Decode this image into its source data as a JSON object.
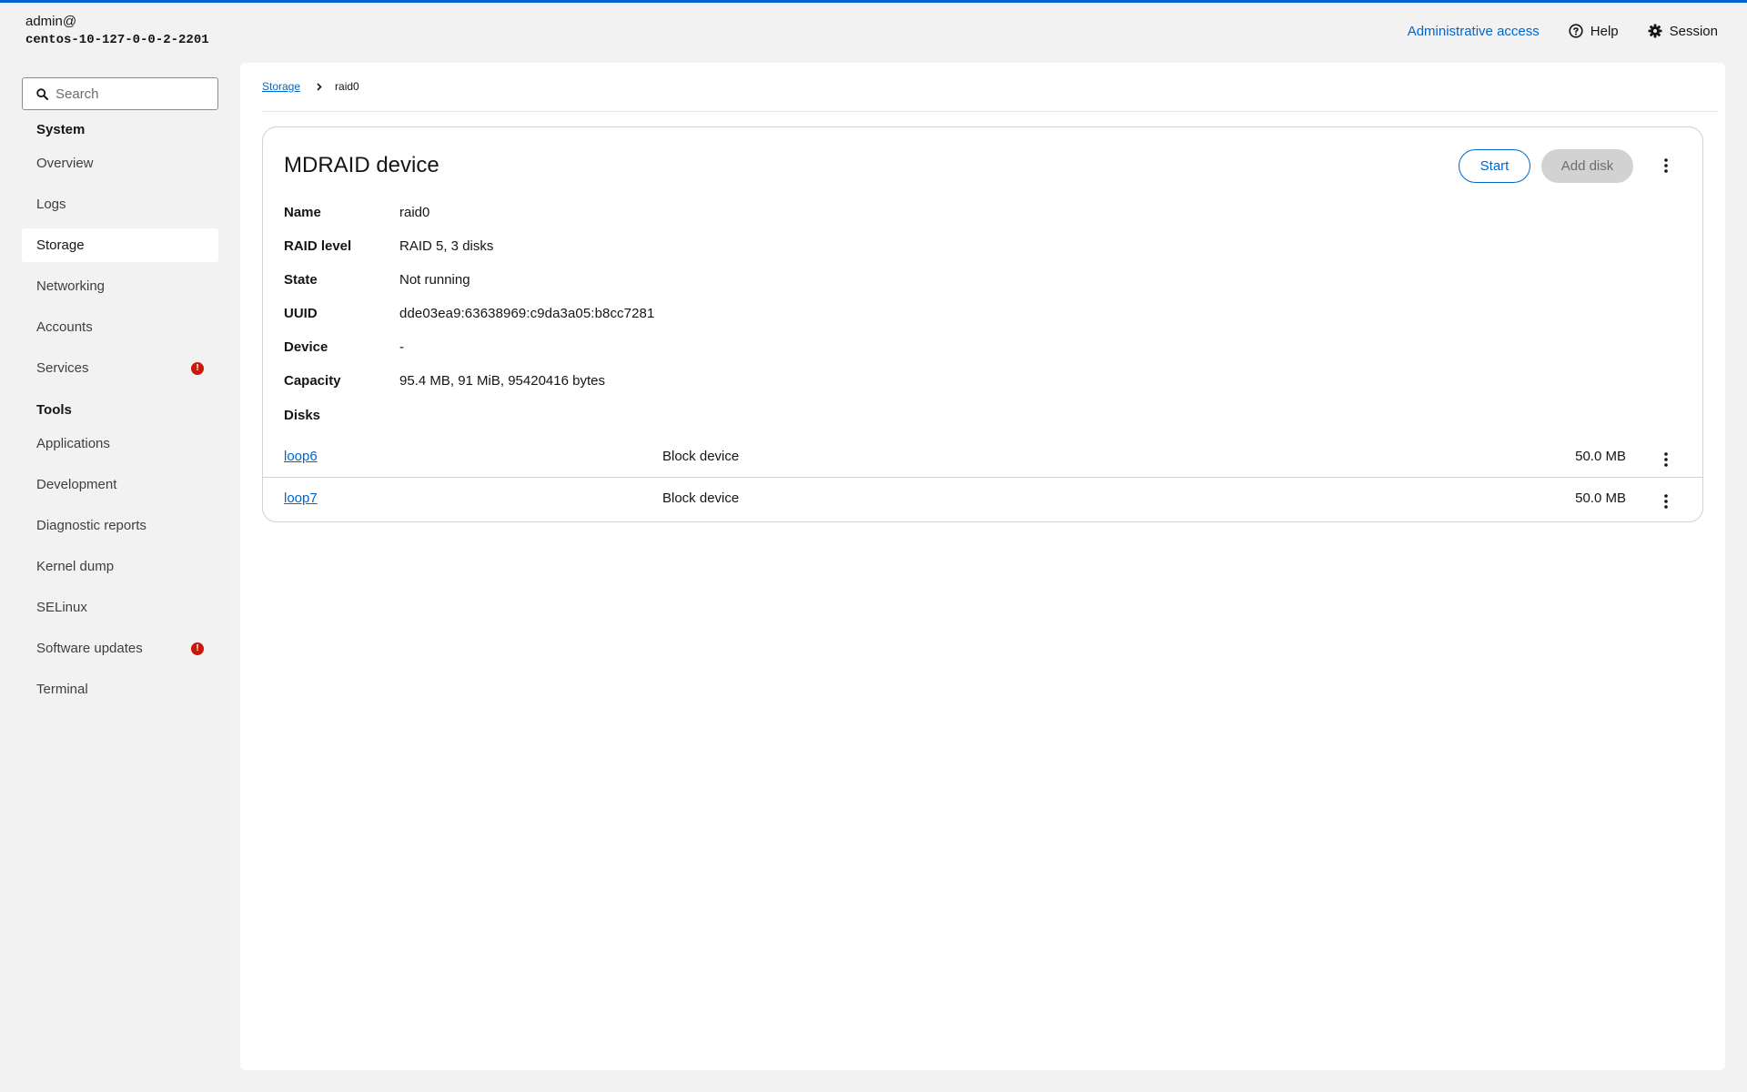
{
  "header": {
    "user": "admin@",
    "hostname": "centos-10-127-0-0-2-2201",
    "admin_access": "Administrative access",
    "help": "Help",
    "session": "Session"
  },
  "sidebar": {
    "search_placeholder": "Search",
    "system_title": "System",
    "system_items": [
      {
        "label": "Overview"
      },
      {
        "label": "Logs"
      },
      {
        "label": "Storage",
        "active": true
      },
      {
        "label": "Networking"
      },
      {
        "label": "Accounts"
      },
      {
        "label": "Services",
        "badge": "!"
      }
    ],
    "tools_title": "Tools",
    "tools_items": [
      {
        "label": "Applications"
      },
      {
        "label": "Development"
      },
      {
        "label": "Diagnostic reports"
      },
      {
        "label": "Kernel dump"
      },
      {
        "label": "SELinux"
      },
      {
        "label": "Software updates",
        "badge": "!"
      },
      {
        "label": "Terminal"
      }
    ]
  },
  "breadcrumb": {
    "parent": "Storage",
    "current": "raid0"
  },
  "card": {
    "title": "MDRAID device",
    "start_label": "Start",
    "add_disk_label": "Add disk",
    "properties": [
      {
        "label": "Name",
        "value": "raid0"
      },
      {
        "label": "RAID level",
        "value": "RAID 5, 3 disks"
      },
      {
        "label": "State",
        "value": "Not running"
      },
      {
        "label": "UUID",
        "value": "dde03ea9:63638969:c9da3a05:b8cc7281"
      },
      {
        "label": "Device",
        "value": "-"
      },
      {
        "label": "Capacity",
        "value": "95.4 MB, 91 MiB, 95420416 bytes"
      }
    ],
    "disks_heading": "Disks",
    "disks": [
      {
        "name": "loop6",
        "type": "Block device",
        "size": "50.0 MB"
      },
      {
        "name": "loop7",
        "type": "Block device",
        "size": "50.0 MB"
      }
    ]
  },
  "colors": {
    "accent": "#0066cc",
    "danger": "#c9190b",
    "background": "#f2f2f2"
  }
}
